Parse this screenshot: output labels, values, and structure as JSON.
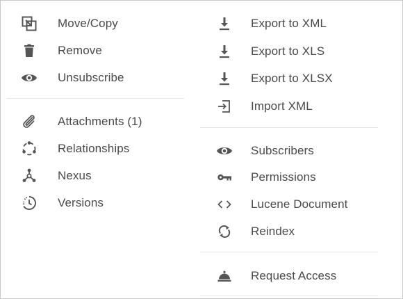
{
  "menu": {
    "left_column": {
      "group_1": [
        {
          "icon": "move-copy-icon",
          "label": "Move/Copy"
        },
        {
          "icon": "trash-icon",
          "label": "Remove"
        },
        {
          "icon": "eye-icon",
          "label": "Unsubscribe"
        }
      ],
      "group_2": [
        {
          "icon": "paperclip-icon",
          "label": "Attachments (1)"
        },
        {
          "icon": "relationships-icon",
          "label": "Relationships"
        },
        {
          "icon": "nexus-icon",
          "label": "Nexus"
        },
        {
          "icon": "history-icon",
          "label": "Versions"
        }
      ]
    },
    "right_column": {
      "group_1": [
        {
          "icon": "download-icon",
          "label": "Export to XML"
        },
        {
          "icon": "download-icon",
          "label": "Export to XLS"
        },
        {
          "icon": "download-icon",
          "label": "Export to XLSX"
        },
        {
          "icon": "import-icon",
          "label": "Import XML"
        }
      ],
      "group_2": [
        {
          "icon": "eye-icon",
          "label": "Subscribers"
        },
        {
          "icon": "key-icon",
          "label": "Permissions"
        },
        {
          "icon": "code-icon",
          "label": "Lucene Document"
        },
        {
          "icon": "sync-icon",
          "label": "Reindex"
        }
      ],
      "group_3": [
        {
          "icon": "bell-icon",
          "label": "Request Access"
        }
      ]
    }
  },
  "colors": {
    "icon": "#555555",
    "text": "#4a4a4a",
    "divider": "#e6e6e6",
    "border": "#c9c9c9"
  }
}
